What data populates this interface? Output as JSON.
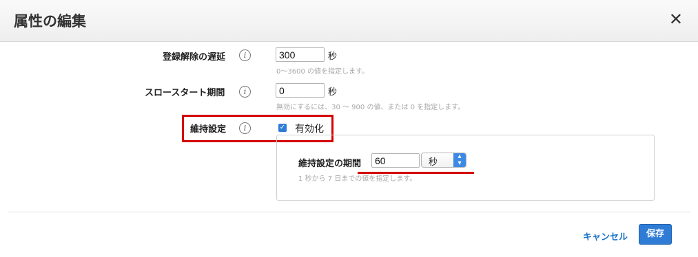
{
  "dialog": {
    "title": "属性の編集",
    "close_glyph": "✕"
  },
  "fields": {
    "deregistration": {
      "label": "登録解除の遅延",
      "value": "300",
      "unit": "秒",
      "hint": "0〜3600 の値を指定します。"
    },
    "slow_start": {
      "label": "スロースタート期間",
      "value": "0",
      "unit": "秒",
      "hint": "無効にするには、30 〜 900 の値、または 0 を指定します。"
    },
    "stickiness": {
      "label": "維持設定",
      "checkbox_label": "有効化",
      "checked": true,
      "duration_label": "維持設定の期間",
      "duration_value": "60",
      "duration_unit": "秒",
      "duration_hint": "1 秒から 7 日までの値を指定します。"
    }
  },
  "footer": {
    "cancel_label": "キャンセル",
    "save_label": "保存"
  },
  "colors": {
    "primary": "#2f7cd6",
    "annotation": "#d40000"
  }
}
